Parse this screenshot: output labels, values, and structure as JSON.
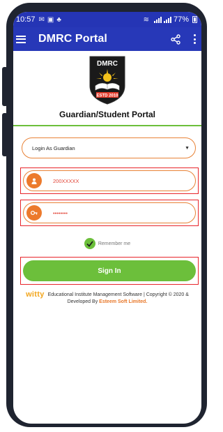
{
  "status_bar": {
    "time": "10:57",
    "battery": "77%",
    "icons": [
      "mail-icon",
      "image-icon",
      "app-icon",
      "wifi-icon",
      "signal-icon"
    ]
  },
  "app_bar": {
    "title": "DMRC Portal"
  },
  "logo": {
    "text_top": "DMRC",
    "text_bottom": "ESTD 2010",
    "colors": {
      "shield": "#1a1a1a",
      "accent": "#e53a2a",
      "sun": "#f3c21b"
    }
  },
  "portal_title": "Guardian/Student Portal",
  "login_type": {
    "selected": "Login As Guardian"
  },
  "username": {
    "value": "200XXXXX",
    "icon": "user-icon"
  },
  "password": {
    "value": "••••••••",
    "icon": "key-icon"
  },
  "remember_me": {
    "label": "Remember me",
    "checked": true
  },
  "signin_label": "Sign In",
  "footer": {
    "brand": "witty",
    "text": "Educational Institute Management Software | Copyright © 2020 & Developed By",
    "company": "Esteem Soft Limited."
  },
  "colors": {
    "primary": "#2738b8",
    "accent_orange": "#e88236",
    "accent_green": "#6cbf3b",
    "highlight_red": "#e8242a"
  }
}
